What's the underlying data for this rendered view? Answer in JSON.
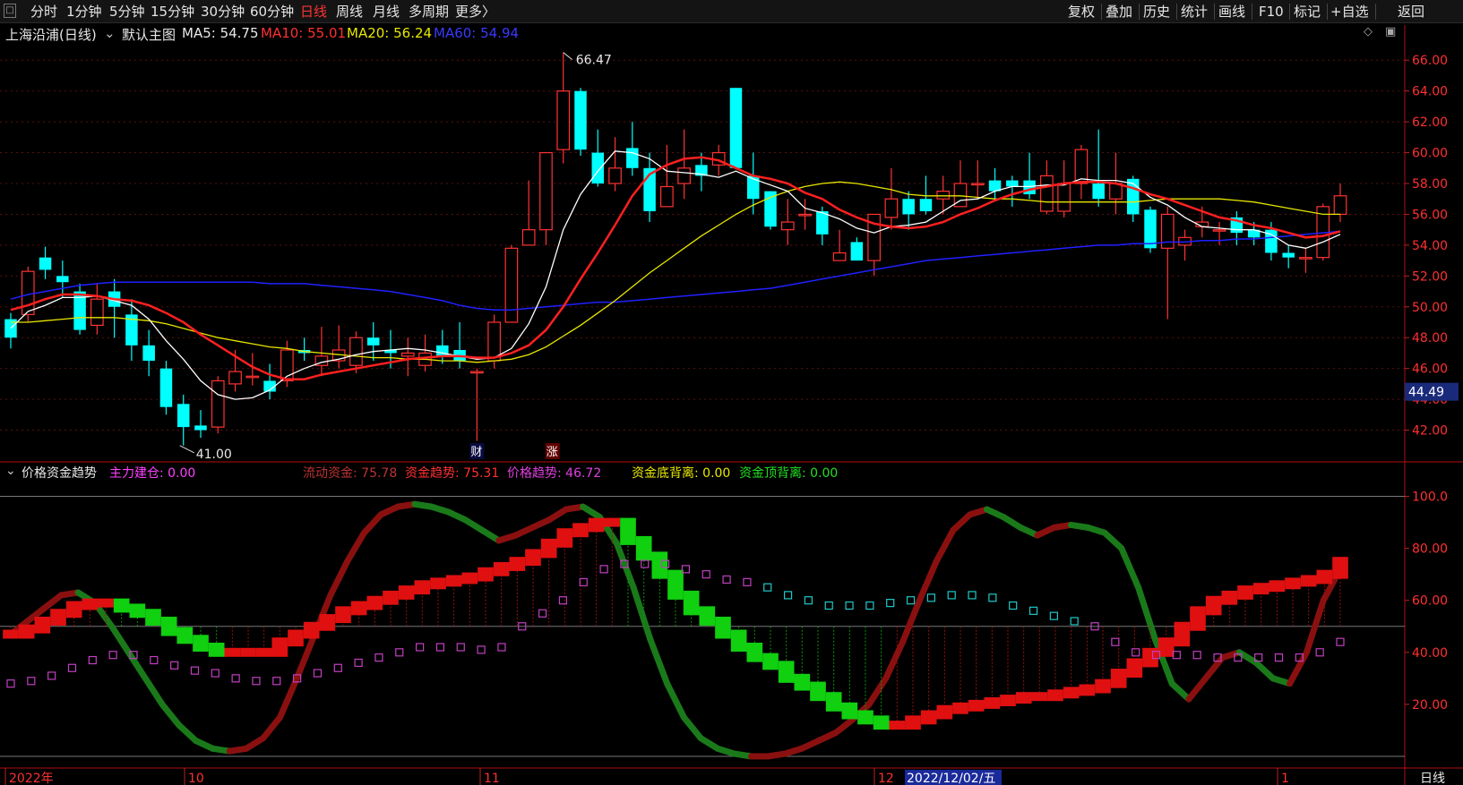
{
  "toolbar": {
    "periods": [
      "分时",
      "1分钟",
      "5分钟",
      "15分钟",
      "30分钟",
      "60分钟",
      "日线",
      "周线",
      "月线",
      "多周期",
      "更多〉"
    ],
    "active_period": "日线",
    "right_buttons": [
      "复权",
      "叠加",
      "历史",
      "统计",
      "画线",
      "F10",
      "标记",
      "+自选",
      "返回"
    ]
  },
  "main_header": {
    "title": "上海沿浦(日线)",
    "default_chart": "默认主图",
    "ma5": "MA5: 54.75",
    "ma10": "MA10: 55.01",
    "ma20": "MA20: 56.24",
    "ma60": "MA60: 54.94"
  },
  "indicator_header": {
    "name": "价格资金趋势",
    "zljc": "主力建仓: 0.00",
    "ldzj": "流动资金: 75.78",
    "zjqs": "资金趋势: 75.31",
    "jgqs": "价格趋势: 46.72",
    "zjdbl": "资金底背离: 0.00",
    "zjdingbl": "资金顶背离: 0.00"
  },
  "markers": {
    "cai": "财",
    "zhang": "涨",
    "high": "66.47",
    "low": "41.00",
    "price_tag": "44.49",
    "bottom_right": "日线"
  },
  "x_axis": [
    "2022年",
    "10",
    "11",
    "12",
    "2022/12/02/五",
    "1"
  ],
  "colors": {
    "up": "#ff3232",
    "down": "#00ffff",
    "ma5": "#ffffff",
    "ma10": "#ff2020",
    "ma20": "#e6e600",
    "ma60": "#2020ff"
  },
  "chart_data": [
    {
      "type": "candlestick",
      "ylim": [
        40,
        67
      ],
      "yticks": [
        "42.00",
        "44.00",
        "46.00",
        "48.00",
        "50.00",
        "52.00",
        "54.00",
        "56.00",
        "58.00",
        "60.00",
        "62.00",
        "64.00",
        "66.00"
      ],
      "grid": true,
      "candles": [
        [
          49.2,
          48.0,
          49.6,
          47.3
        ],
        [
          49.5,
          52.3,
          52.6,
          49.0
        ],
        [
          53.2,
          52.4,
          53.9,
          51.8
        ],
        [
          52.0,
          51.6,
          53.0,
          50.6
        ],
        [
          51.0,
          48.5,
          51.5,
          48.2
        ],
        [
          48.8,
          50.5,
          51.5,
          48.2
        ],
        [
          51.0,
          50.0,
          51.8,
          48.0
        ],
        [
          49.5,
          47.5,
          50.5,
          46.5
        ],
        [
          47.5,
          46.5,
          48.5,
          45.5
        ],
        [
          46.0,
          43.5,
          46.5,
          43.0
        ],
        [
          43.7,
          42.2,
          44.3,
          41.0
        ],
        [
          42.3,
          42.0,
          43.3,
          41.5
        ],
        [
          42.2,
          45.2,
          45.5,
          41.8
        ],
        [
          45.0,
          45.8,
          47.2,
          44.5
        ],
        [
          45.5,
          45.5,
          47.0,
          44.9
        ],
        [
          45.2,
          44.5,
          46.3,
          44.0
        ],
        [
          45.2,
          47.2,
          47.8,
          44.8
        ],
        [
          47.2,
          47.0,
          48.0,
          46.5
        ],
        [
          46.2,
          46.8,
          48.7,
          45.5
        ],
        [
          46.5,
          47.2,
          48.8,
          46.0
        ],
        [
          46.2,
          48.0,
          48.4,
          45.7
        ],
        [
          48.0,
          47.5,
          49.0,
          46.5
        ],
        [
          47.2,
          47.0,
          48.5,
          46.0
        ],
        [
          46.8,
          47.0,
          48.0,
          45.5
        ],
        [
          46.2,
          47.0,
          48.2,
          45.8
        ],
        [
          47.5,
          46.8,
          48.5,
          46.3
        ],
        [
          47.2,
          46.5,
          49.0,
          46.0
        ],
        [
          45.8,
          45.8,
          46.0,
          41.3
        ],
        [
          46.5,
          49.0,
          49.5,
          46.0
        ],
        [
          49.0,
          53.8,
          54.0,
          49.0
        ],
        [
          54.0,
          55.0,
          58.2,
          54.0
        ],
        [
          55.0,
          60.0,
          60.0,
          54.0
        ],
        [
          60.2,
          64.0,
          66.5,
          59.3
        ],
        [
          64.0,
          60.2,
          64.2,
          59.8
        ],
        [
          60.0,
          58.0,
          61.5,
          57.8
        ],
        [
          58.0,
          59.0,
          61.0,
          57.5
        ],
        [
          60.3,
          59.0,
          62.0,
          58.5
        ],
        [
          59.0,
          56.2,
          60.0,
          55.5
        ],
        [
          56.5,
          57.8,
          60.5,
          56.5
        ],
        [
          58.0,
          59.0,
          61.5,
          57.0
        ],
        [
          59.2,
          58.5,
          60.0,
          57.5
        ],
        [
          59.2,
          60.0,
          60.5,
          58.5
        ],
        [
          64.2,
          59.0,
          64.2,
          59.0
        ],
        [
          58.5,
          57.0,
          60.0,
          56.0
        ],
        [
          57.5,
          55.2,
          57.5,
          55.0
        ],
        [
          55.0,
          55.5,
          57.0,
          54.0
        ],
        [
          56.0,
          56.0,
          57.0,
          55.0
        ],
        [
          56.2,
          54.7,
          56.5,
          54.0
        ],
        [
          53.0,
          53.5,
          55.0,
          53.0
        ],
        [
          54.2,
          53.0,
          54.5,
          53.0
        ],
        [
          53.0,
          56.0,
          56.0,
          52.0
        ],
        [
          55.8,
          57.0,
          59.0,
          55.0
        ],
        [
          57.0,
          56.0,
          57.5,
          55.0
        ],
        [
          57.0,
          56.2,
          58.5,
          56.0
        ],
        [
          57.0,
          57.5,
          58.5,
          56.0
        ],
        [
          56.5,
          58.0,
          59.5,
          56.5
        ],
        [
          58.0,
          58.0,
          59.5,
          57.0
        ],
        [
          58.2,
          57.5,
          59.0,
          57.0
        ],
        [
          58.2,
          57.8,
          58.5,
          56.5
        ],
        [
          58.2,
          57.3,
          60.0,
          57.0
        ],
        [
          56.2,
          58.5,
          59.5,
          56.0
        ],
        [
          56.2,
          58.0,
          59.5,
          55.8
        ],
        [
          58.0,
          60.2,
          60.5,
          57.0
        ],
        [
          58.0,
          57.0,
          61.5,
          56.5
        ],
        [
          57.0,
          58.0,
          60.0,
          56.0
        ],
        [
          58.3,
          56.0,
          58.5,
          55.5
        ],
        [
          56.3,
          53.8,
          56.5,
          53.5
        ],
        [
          53.8,
          56.0,
          56.5,
          49.2
        ],
        [
          54.0,
          54.5,
          55.0,
          53.0
        ],
        [
          55.2,
          55.5,
          56.5,
          54.5
        ],
        [
          55.0,
          55.0,
          55.5,
          54.0
        ],
        [
          55.8,
          54.8,
          56.2,
          54.0
        ],
        [
          55.0,
          54.5,
          55.5,
          54.0
        ],
        [
          55.0,
          53.5,
          55.5,
          53.0
        ],
        [
          53.5,
          53.2,
          54.0,
          52.5
        ],
        [
          53.2,
          53.2,
          53.8,
          52.2
        ],
        [
          53.2,
          56.5,
          56.7,
          53.0
        ],
        [
          56.0,
          57.2,
          58.0,
          55.5
        ]
      ],
      "ma5": [
        48.6,
        49.7,
        50.1,
        50.6,
        50.6,
        50.7,
        50.4,
        50.1,
        49.2,
        47.8,
        46.6,
        45.2,
        44.3,
        44.0,
        44.1,
        44.6,
        45.5,
        46.0,
        46.4,
        46.6,
        46.9,
        47.1,
        47.2,
        47.3,
        47.2,
        47.0,
        46.8,
        46.6,
        46.7,
        47.3,
        48.9,
        51.3,
        55.0,
        57.3,
        58.8,
        60.1,
        60.0,
        59.6,
        58.8,
        58.7,
        58.6,
        58.4,
        58.8,
        58.3,
        57.9,
        57.5,
        56.4,
        56.1,
        55.7,
        55.1,
        54.8,
        55.2,
        55.3,
        55.5,
        56.2,
        56.9,
        57.0,
        57.5,
        57.8,
        57.8,
        57.9,
        57.9,
        58.3,
        58.2,
        58.2,
        58.0,
        57.1,
        56.6,
        55.8,
        55.2,
        55.1,
        55.0,
        55.0,
        54.7,
        54.0,
        53.8,
        54.2,
        54.7
      ],
      "ma10": [
        49.8,
        50.1,
        50.5,
        50.8,
        50.8,
        50.7,
        50.5,
        50.4,
        50.1,
        49.6,
        49.0,
        48.2,
        47.5,
        46.8,
        46.1,
        45.6,
        45.3,
        45.3,
        45.6,
        45.8,
        46.0,
        46.2,
        46.4,
        46.6,
        46.7,
        46.8,
        46.8,
        46.7,
        46.7,
        47.0,
        47.5,
        48.5,
        50.0,
        51.8,
        53.5,
        55.3,
        57.2,
        58.6,
        59.2,
        59.6,
        59.7,
        59.5,
        59.0,
        58.5,
        58.3,
        58.0,
        57.4,
        57.0,
        56.3,
        55.8,
        55.4,
        55.2,
        55.1,
        55.2,
        55.5,
        56.0,
        56.4,
        56.9,
        57.3,
        57.6,
        57.8,
        58.0,
        58.1,
        58.1,
        58.0,
        57.7,
        57.3,
        57.0,
        56.6,
        56.2,
        55.8,
        55.6,
        55.3,
        55.1,
        54.8,
        54.5,
        54.6,
        54.9
      ],
      "ma20": [
        49.0,
        49.0,
        49.1,
        49.2,
        49.3,
        49.3,
        49.3,
        49.2,
        49.1,
        48.9,
        48.6,
        48.3,
        48.0,
        47.8,
        47.6,
        47.4,
        47.3,
        47.1,
        47.0,
        46.9,
        46.8,
        46.7,
        46.7,
        46.6,
        46.6,
        46.5,
        46.5,
        46.4,
        46.5,
        46.6,
        46.9,
        47.4,
        48.1,
        48.8,
        49.6,
        50.4,
        51.3,
        52.2,
        53.0,
        53.8,
        54.6,
        55.3,
        56.0,
        56.6,
        57.1,
        57.5,
        57.8,
        58.0,
        58.1,
        58.0,
        57.8,
        57.6,
        57.3,
        57.2,
        57.2,
        57.2,
        57.1,
        57.0,
        57.0,
        56.9,
        56.8,
        56.8,
        56.8,
        56.8,
        56.8,
        56.8,
        56.9,
        57.0,
        57.0,
        57.0,
        57.0,
        56.9,
        56.8,
        56.6,
        56.4,
        56.2,
        56.0,
        56.0
      ],
      "ma60": [
        50.5,
        50.8,
        51.0,
        51.2,
        51.4,
        51.5,
        51.6,
        51.6,
        51.6,
        51.6,
        51.6,
        51.6,
        51.6,
        51.6,
        51.6,
        51.5,
        51.5,
        51.5,
        51.4,
        51.3,
        51.2,
        51.1,
        51.0,
        50.8,
        50.6,
        50.4,
        50.1,
        49.9,
        49.8,
        49.8,
        49.9,
        50.0,
        50.1,
        50.2,
        50.3,
        50.3,
        50.4,
        50.5,
        50.6,
        50.7,
        50.8,
        50.9,
        51.0,
        51.1,
        51.2,
        51.4,
        51.6,
        51.8,
        52.0,
        52.2,
        52.4,
        52.6,
        52.8,
        53.0,
        53.1,
        53.2,
        53.3,
        53.4,
        53.5,
        53.6,
        53.7,
        53.8,
        53.9,
        54.0,
        54.0,
        54.1,
        54.1,
        54.2,
        54.2,
        54.3,
        54.3,
        54.4,
        54.4,
        54.5,
        54.6,
        54.7,
        54.8,
        54.9
      ]
    },
    {
      "type": "indicator",
      "ylim": [
        0,
        105
      ],
      "yticks": [
        "20.00",
        "40.00",
        "60.00",
        "80.00",
        "100.0"
      ],
      "wave": [
        47,
        52,
        57,
        62,
        63,
        59,
        50,
        40,
        30,
        20,
        12,
        6,
        3,
        2,
        3,
        7,
        15,
        30,
        46,
        62,
        75,
        86,
        93,
        96,
        97,
        96,
        94,
        91,
        87,
        83,
        85,
        88,
        91,
        95,
        96,
        92,
        82,
        65,
        45,
        28,
        15,
        7,
        3,
        1,
        0,
        0,
        1,
        3,
        6,
        9,
        14,
        20,
        30,
        44,
        60,
        75,
        87,
        93,
        95,
        92,
        88,
        85,
        88,
        89,
        88,
        86,
        80,
        65,
        45,
        28,
        22,
        30,
        38,
        40,
        36,
        30,
        28,
        40,
        60,
        72
      ],
      "price_trend": [
        47,
        49,
        52,
        55,
        58,
        59,
        59,
        57,
        55,
        52,
        48,
        45,
        42,
        40,
        40,
        40,
        40,
        44,
        47,
        50,
        53,
        56,
        58,
        60,
        62,
        64,
        66,
        67,
        68,
        69,
        71,
        73,
        75,
        78,
        82,
        86,
        88,
        90,
        90,
        83,
        77,
        70,
        62,
        56,
        52,
        47,
        42,
        38,
        35,
        30,
        27,
        23,
        19,
        16,
        14,
        12,
        12,
        14,
        16,
        18,
        19,
        20,
        21,
        22,
        23,
        23,
        24,
        25,
        26,
        28,
        32,
        36,
        40,
        44,
        50,
        56,
        60,
        62,
        64,
        65,
        66,
        67,
        68,
        70,
        75
      ],
      "fund_trend": [
        28,
        29,
        31,
        34,
        37,
        39,
        39,
        37,
        35,
        33,
        32,
        30,
        29,
        29,
        30,
        32,
        34,
        36,
        38,
        40,
        42,
        42,
        42,
        41,
        42,
        50,
        55,
        60,
        67,
        72,
        74,
        74,
        74,
        72,
        70,
        68,
        67,
        65,
        62,
        60,
        58,
        58,
        58,
        59,
        60,
        61,
        62,
        62,
        61,
        58,
        56,
        54,
        52,
        50,
        44,
        40,
        39,
        39,
        39,
        38,
        38,
        38,
        38,
        38,
        40,
        44
      ]
    }
  ]
}
